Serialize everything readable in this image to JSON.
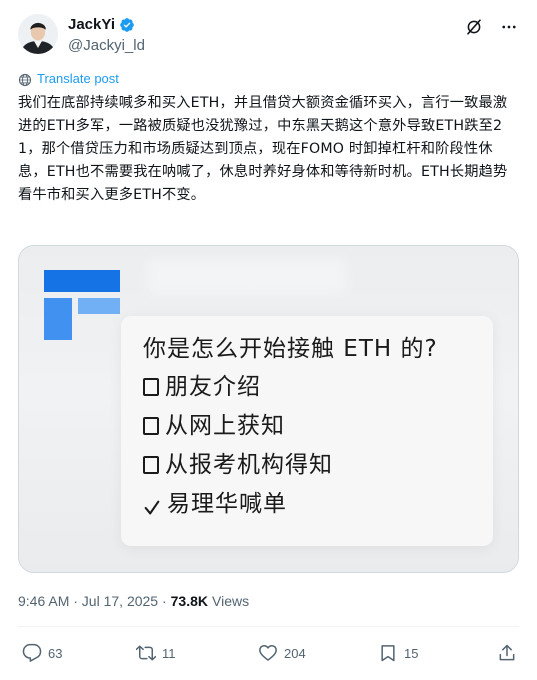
{
  "author": {
    "display_name": "JackYi",
    "handle": "@Jackyi_ld",
    "verified": true
  },
  "translate_label": "Translate post",
  "post_text": "我们在底部持续喊多和买入ETH，并且借贷大额资金循环买入，言行一致最激进的ETH多军，一路被质疑也没犹豫过，中东黑天鹅这个意外导致ETH跌至21，那个借贷压力和市场质疑达到顶点，现在FOMO 时卸掉杠杆和阶段性休息，ETH也不需要我在呐喊了，休息时养好身体和等待新时机。ETH长期趋势看牛市和买入更多ETH不变。",
  "image": {
    "question": "你是怎么开始接触 ETH 的?",
    "options": [
      {
        "label": "朋友介绍",
        "checked": false
      },
      {
        "label": "从网上获知",
        "checked": false
      },
      {
        "label": "从报考机构得知",
        "checked": false
      },
      {
        "label": "易理华喊单",
        "checked": true
      }
    ]
  },
  "meta": {
    "timestamp": "9:46 AM · Jul 17, 2025 ·",
    "views_count": "73.8K",
    "views_label": "Views"
  },
  "actions": {
    "replies": "63",
    "reposts": "11",
    "likes": "204",
    "bookmarks": "15"
  },
  "colors": {
    "accent": "#1d9bf0",
    "text_primary": "#0f1419",
    "text_secondary": "#536471",
    "logo_blue": "#1673e6"
  },
  "icons": {
    "header": [
      "verified-badge-icon",
      "grok-icon",
      "more-icon"
    ],
    "translate": "globe-icon",
    "actions": [
      "reply-icon",
      "repost-icon",
      "like-icon",
      "bookmark-icon",
      "share-icon"
    ]
  }
}
